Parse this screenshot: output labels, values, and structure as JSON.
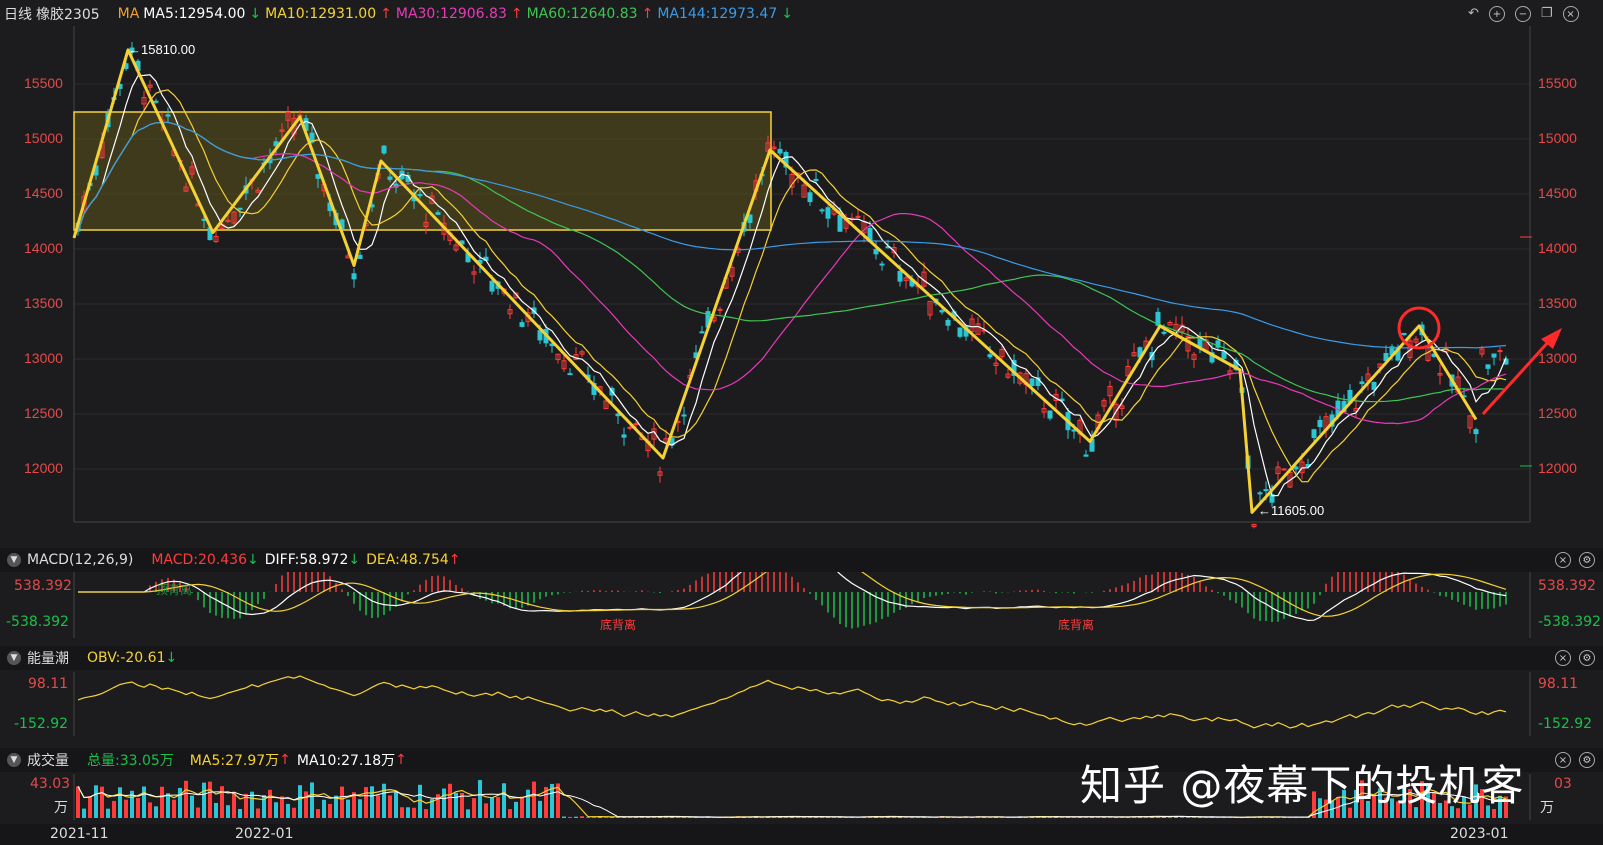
{
  "main_header": {
    "period": "日线",
    "symbol": "橡胶2305",
    "ma_label": "MA",
    "ma5": "MA5:12954.00",
    "ma10": "MA10:12931.00",
    "ma30": "MA30:12906.83",
    "ma60": "MA60:12640.83",
    "ma144": "MA144:12973.47",
    "arrow_up": "↑",
    "arrow_down": "↓"
  },
  "colors": {
    "ma5": "#ffffff",
    "ma10": "#f5d233",
    "ma30": "#e83ab8",
    "ma60": "#3fc553",
    "ma144": "#3a9be8",
    "rise": "#ff3b3b",
    "fall": "#2bc6d6",
    "zigzag": "#f5d233"
  },
  "price_ticks": [
    "15500",
    "15000",
    "14500",
    "14000",
    "13500",
    "13000",
    "12500",
    "12000"
  ],
  "annotations": {
    "high": "←15810.00",
    "low": "←11605.00"
  },
  "macd_header": {
    "name": "MACD(12,26,9)",
    "macd": "MACD:20.436",
    "diff": "DIFF:58.972",
    "dea": "DEA:48.754",
    "top": "538.392",
    "bottom": "-538.392",
    "divergence_label": "底背离",
    "divergence_label_faint": "顶背离"
  },
  "obv_header": {
    "name": "能量潮",
    "obv": "OBV:-20.61",
    "top": "98.11",
    "bottom": "-152.92"
  },
  "vol_header": {
    "name": "成交量",
    "total": "总量:33.05万",
    "ma5": "MA5:27.97万",
    "ma10": "MA10:27.18万",
    "top": "43.03",
    "unit": "万",
    "top_right": "03"
  },
  "date_axis": [
    "2021-11",
    "2022-01",
    "2023-01"
  ],
  "watermark": "知乎 @夜幕下的投机客",
  "toolbar_icons": [
    "undo-icon",
    "zoom-in-icon",
    "zoom-out-icon",
    "restore-icon",
    "settings-icon"
  ],
  "chart_data": {
    "type": "candlestick",
    "title": "橡胶2305",
    "xlabel": "",
    "ylabel": "",
    "ylim": [
      11600,
      15800
    ],
    "x_ticks": [
      "2021-11",
      "2022-01",
      "2023-01"
    ],
    "zigzag_pivots": [
      14100,
      15810,
      14150,
      15200,
      13850,
      14800,
      12100,
      14900,
      12800,
      14000,
      12900,
      13350,
      12250,
      13300,
      11605,
      13300,
      12450,
      13050
    ],
    "box": {
      "price_top": 15220,
      "price_bottom": 14150
    },
    "extremes": {
      "high": 15810,
      "low": 11605
    },
    "legend_position": "top-left",
    "grid": true
  }
}
